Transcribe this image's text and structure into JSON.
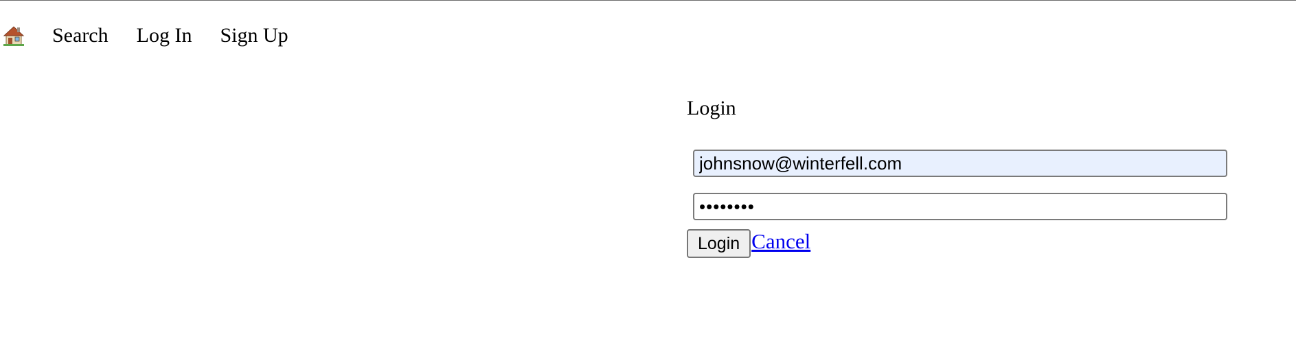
{
  "nav": {
    "home_icon": "house-emoji-icon",
    "items": [
      {
        "label": "Search"
      },
      {
        "label": "Log In"
      },
      {
        "label": "Sign Up"
      }
    ]
  },
  "login": {
    "title": "Login",
    "email": {
      "value": "johnsnow@winterfell.com",
      "autofill_bg": "#e8f0fe"
    },
    "password": {
      "value": "••••••••"
    },
    "submit_label": "Login",
    "cancel_label": "Cancel",
    "link_color": "#0000ee"
  }
}
